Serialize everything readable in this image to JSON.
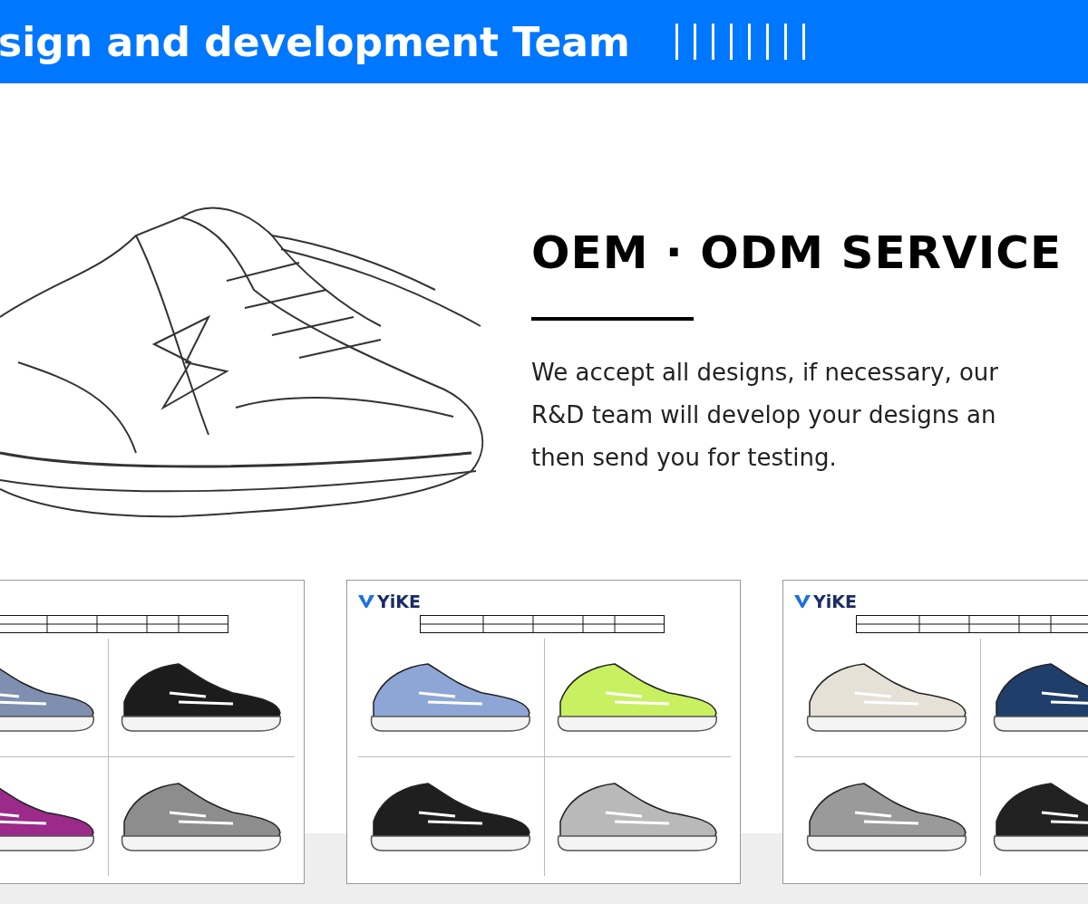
{
  "banner": {
    "title": "sign and development Team"
  },
  "service": {
    "title": "OEM · ODM SERVICE",
    "text": "We accept all designs, if necessary, our\nR&D team will develop your designs an\nthen send you for testing."
  },
  "sheets": [
    {
      "shoes": [
        {
          "color": "#7f8fb0"
        },
        {
          "color": "#1c1c1c"
        },
        {
          "color": "#9b2a8a"
        },
        {
          "color": "#8d8d8d"
        }
      ]
    },
    {
      "logo": "YiKE",
      "shoes": [
        {
          "color": "#8ea6d6"
        },
        {
          "color": "#c9f060"
        },
        {
          "color": "#1f1f1f"
        },
        {
          "color": "#b9b9b9"
        }
      ]
    },
    {
      "logo": "YiKE",
      "shoes": [
        {
          "color": "#e6e1d6"
        },
        {
          "color": "#1f3e6a"
        },
        {
          "color": "#9a9a9a"
        },
        {
          "color": "#222222"
        }
      ]
    }
  ]
}
